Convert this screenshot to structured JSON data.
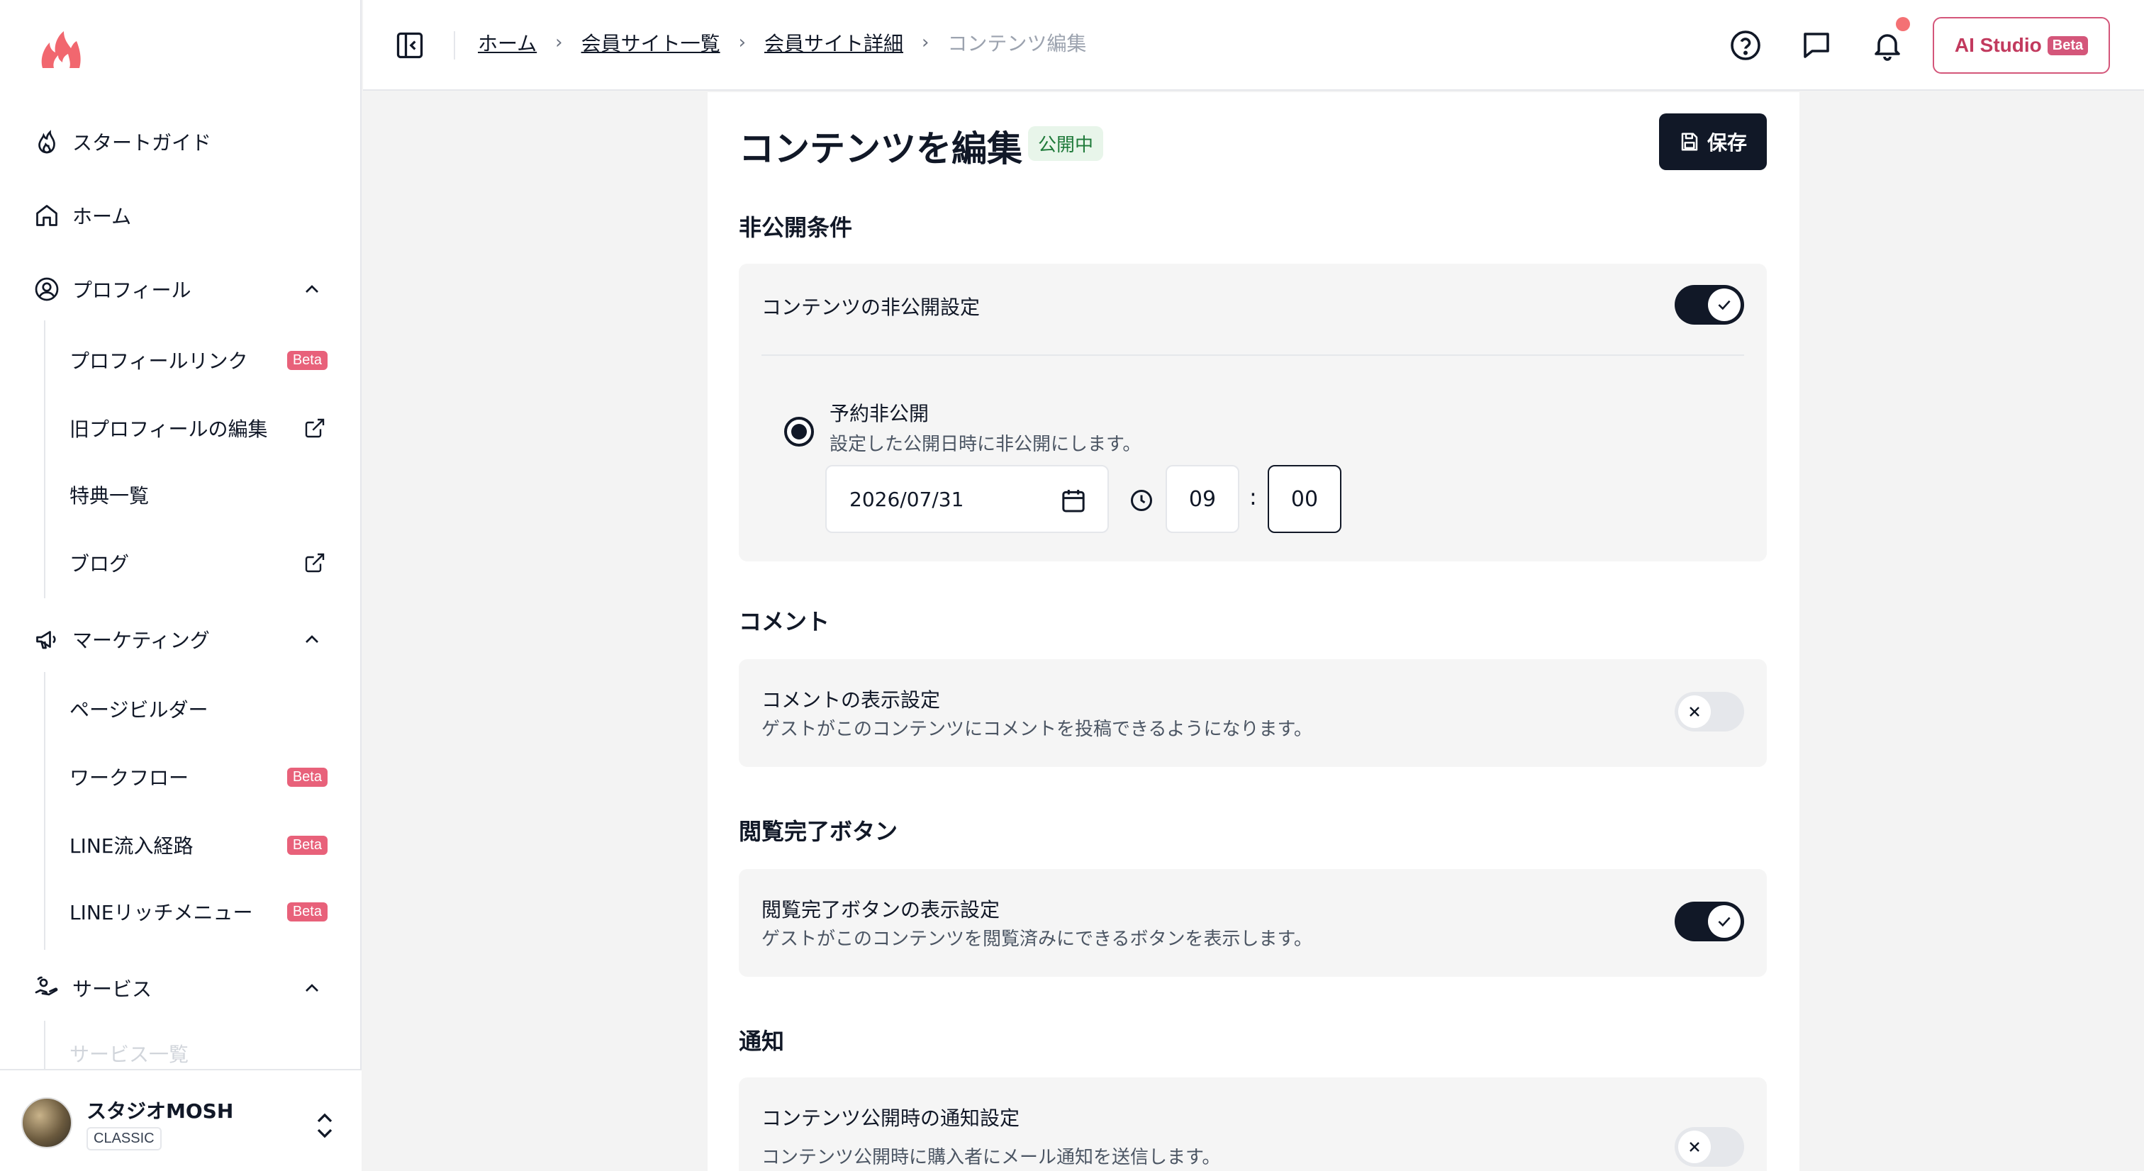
{
  "sidebar": {
    "nav": [
      {
        "label": "スタートガイド",
        "icon": "flame-icon"
      },
      {
        "label": "ホーム",
        "icon": "home-icon"
      },
      {
        "label": "プロフィール",
        "icon": "user-circle-icon"
      },
      {
        "label": "マーケティング",
        "icon": "megaphone-icon"
      },
      {
        "label": "サービス",
        "icon": "service-hand-icon"
      }
    ],
    "profile_sub": [
      {
        "label": "プロフィールリンク",
        "badge": "Beta"
      },
      {
        "label": "旧プロフィールの編集"
      },
      {
        "label": "特典一覧"
      },
      {
        "label": "ブログ"
      }
    ],
    "marketing_sub": [
      {
        "label": "ページビルダー"
      },
      {
        "label": "ワークフロー",
        "badge": "Beta"
      },
      {
        "label": "LINE流入経路",
        "badge": "Beta"
      },
      {
        "label": "LINEリッチメニュー",
        "badge": "Beta"
      }
    ],
    "service_sub": [
      {
        "label": "サービス一覧"
      }
    ],
    "account": {
      "name": "スタジオMOSH",
      "plan": "CLASSIC"
    }
  },
  "header": {
    "breadcrumb": [
      "ホーム",
      "会員サイト一覧",
      "会員サイト詳細",
      "コンテンツ編集"
    ],
    "ai_studio": {
      "label": "AI Studio",
      "badge": "Beta"
    }
  },
  "main": {
    "title": "コンテンツを編集",
    "status": "公開中",
    "save_label": "保存",
    "sections": {
      "unpublish": {
        "title": "非公開条件",
        "setting_label": "コンテンツの非公開設定",
        "enabled": true,
        "option_label": "予約非公開",
        "option_desc": "設定した公開日時に非公開にします。",
        "date": "2026/07/31",
        "hour": "09",
        "minute": "00",
        "colon": ":"
      },
      "comment": {
        "title": "コメント",
        "label": "コメントの表示設定",
        "desc": "ゲストがこのコンテンツにコメントを投稿できるようになります。",
        "enabled": false
      },
      "complete": {
        "title": "閲覧完了ボタン",
        "label": "閲覧完了ボタンの表示設定",
        "desc": "ゲストがこのコンテンツを閲覧済みにできるボタンを表示します。",
        "enabled": true
      },
      "notify": {
        "title": "通知",
        "label": "コンテンツ公開時の通知設定",
        "desc": "コンテンツ公開時に購入者にメール通知を送信します。",
        "enabled": false
      }
    }
  },
  "colors": {
    "accent": "#111827",
    "brand": "#f1676f",
    "beta": "#e8617a",
    "published": "#1f7a3a"
  }
}
